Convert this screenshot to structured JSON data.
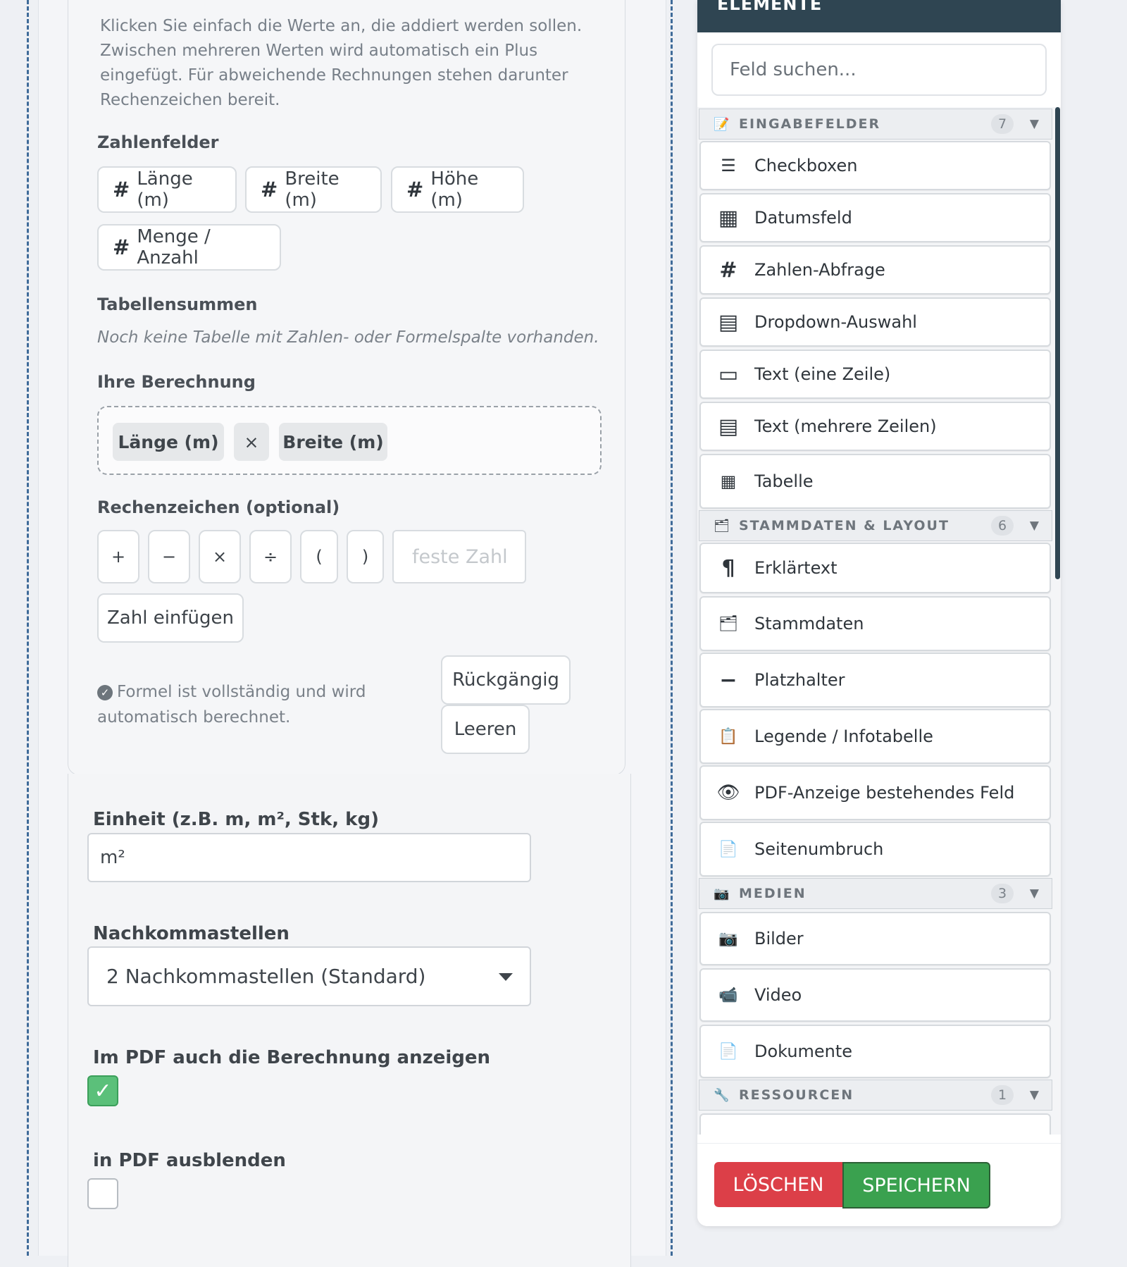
{
  "calc_panel": {
    "help_text": "Klicken Sie einfach die Werte an, die addiert werden sollen. Zwischen mehreren Werten wird automatisch ein Plus eingefügt. Für abweichende Rechnungen stehen darunter Rechenzeichen bereit.",
    "number_fields_heading": "Zahlenfelder",
    "number_fields": [
      "Länge (m)",
      "Breite (m)",
      "Höhe (m)",
      "Menge / Anzahl"
    ],
    "table_sums_heading": "Tabellensummen",
    "table_sums_note": "Noch keine Tabelle mit Zahlen- oder Formelspalte vorhanden.",
    "formula_heading": "Ihre Berechnung",
    "formula_tokens": [
      "Länge (m)",
      "×",
      "Breite (m)"
    ],
    "operators_heading": "Rechenzeichen (optional)",
    "operators": [
      "+",
      "−",
      "×",
      "÷",
      "(",
      ")"
    ],
    "fixed_number_placeholder": "feste Zahl",
    "insert_number_label": "Zahl einfügen",
    "status_text": "Formel ist vollständig und wird automatisch berechnet.",
    "undo_label": "Rückgängig",
    "clear_label": "Leeren"
  },
  "field_settings": {
    "unit_label": "Einheit (z.B. m, m², Stk, kg)",
    "unit_value": "m²",
    "decimals_label": "Nachkommastellen",
    "decimals_value": "2 Nachkommastellen (Standard)",
    "show_calc_label": "Im PDF auch die Berechnung anzeigen",
    "show_calc_checked": true,
    "hide_pdf_label": "in PDF ausblenden",
    "hide_pdf_checked": false
  },
  "sidebar": {
    "title": "ELEMENTE",
    "search_placeholder": "Feld suchen...",
    "categories": [
      {
        "label": "EINGABEFELDER",
        "count": "7",
        "icon": "memo-icon",
        "items": [
          {
            "label": "Checkboxen",
            "icon": "checklist-icon"
          },
          {
            "label": "Datumsfeld",
            "icon": "calendar-icon"
          },
          {
            "label": "Zahlen-Abfrage",
            "icon": "hash-icon"
          },
          {
            "label": "Dropdown-Auswahl",
            "icon": "dropdown-icon"
          },
          {
            "label": "Text (eine Zeile)",
            "icon": "text-line-icon"
          },
          {
            "label": "Text (mehrere Zeilen)",
            "icon": "text-area-icon"
          },
          {
            "label": "Tabelle",
            "icon": "table-icon"
          }
        ]
      },
      {
        "label": "STAMMDATEN & LAYOUT",
        "count": "6",
        "icon": "card-index-icon",
        "items": [
          {
            "label": "Erklärtext",
            "icon": "pilcrow-icon"
          },
          {
            "label": "Stammdaten",
            "icon": "card-index-icon"
          },
          {
            "label": "Platzhalter",
            "icon": "minus-icon"
          },
          {
            "label": "Legende / Infotabelle",
            "icon": "clipboard-icon"
          },
          {
            "label": "PDF-Anzeige bestehendes Feld",
            "icon": "eye-icon"
          },
          {
            "label": "Seitenumbruch",
            "icon": "page-icon"
          }
        ]
      },
      {
        "label": "MEDIEN",
        "count": "3",
        "icon": "camera-icon",
        "items": [
          {
            "label": "Bilder",
            "icon": "camera-icon"
          },
          {
            "label": "Video",
            "icon": "video-camera-icon"
          },
          {
            "label": "Dokumente",
            "icon": "page-icon"
          }
        ]
      },
      {
        "label": "RESSOURCEN",
        "count": "1",
        "icon": "wrench-icon",
        "items": []
      }
    ],
    "delete_label": "LÖSCHEN",
    "save_label": "SPEICHERN"
  }
}
